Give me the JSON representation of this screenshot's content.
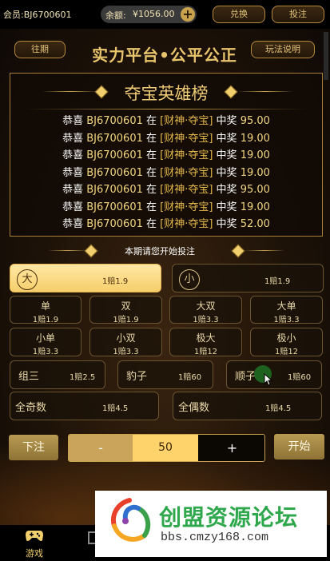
{
  "topbar": {
    "member_text": "会员:BJ6700601",
    "balance_label": "余额:",
    "balance_value": "¥1056.00",
    "exchange_label": "兑换",
    "bet_label": "投注"
  },
  "header": {
    "past_label": "往期",
    "title": "实力平台•公平公正",
    "rules_label": "玩法说明"
  },
  "board": {
    "title": "夺宝英雄榜",
    "rows": [
      {
        "prefix": "恭喜 ",
        "uid": "BJ6700601",
        "mid": " 在 ",
        "game": "[财神·夺宝]",
        "suffix": " 中奖 ",
        "amount": "95.00"
      },
      {
        "prefix": "恭喜 ",
        "uid": "BJ6700601",
        "mid": " 在 ",
        "game": "[财神·夺宝]",
        "suffix": " 中奖 ",
        "amount": "19.00"
      },
      {
        "prefix": "恭喜 ",
        "uid": "BJ6700601",
        "mid": " 在 ",
        "game": "[财神·夺宝]",
        "suffix": " 中奖 ",
        "amount": "19.00"
      },
      {
        "prefix": "恭喜 ",
        "uid": "BJ6700601",
        "mid": " 在 ",
        "game": "[财神·夺宝]",
        "suffix": " 中奖 ",
        "amount": "19.00"
      },
      {
        "prefix": "恭喜 ",
        "uid": "BJ6700601",
        "mid": " 在 ",
        "game": "[财神·夺宝]",
        "suffix": " 中奖 ",
        "amount": "95.00"
      },
      {
        "prefix": "恭喜 ",
        "uid": "BJ6700601",
        "mid": " 在 ",
        "game": "[财神·夺宝]",
        "suffix": " 中奖 ",
        "amount": "19.00"
      },
      {
        "prefix": "恭喜 ",
        "uid": "BJ6700601",
        "mid": " 在 ",
        "game": "[财神·夺宝]",
        "suffix": " 中奖 ",
        "amount": "52.00"
      }
    ]
  },
  "subheader": {
    "text": "本期请您开始投注"
  },
  "bets": {
    "big": {
      "label": "大",
      "odds": "1赔1.9"
    },
    "small": {
      "label": "小",
      "odds": "1赔1.9"
    },
    "grid": [
      {
        "label": "单",
        "odds": "1赔1.9"
      },
      {
        "label": "双",
        "odds": "1赔1.9"
      },
      {
        "label": "大双",
        "odds": "1赔3.3"
      },
      {
        "label": "大单",
        "odds": "1赔3.3"
      },
      {
        "label": "小单",
        "odds": "1赔3.3"
      },
      {
        "label": "小双",
        "odds": "1赔3.3"
      },
      {
        "label": "极大",
        "odds": "1赔12"
      },
      {
        "label": "极小",
        "odds": "1赔12"
      }
    ],
    "group3": {
      "label": "组三",
      "odds": "1赔2.5"
    },
    "leopard": {
      "label": "豹子",
      "odds": "1赔60"
    },
    "straight": {
      "label": "顺子",
      "odds": "1赔60"
    },
    "all_odd": {
      "label": "全奇数",
      "odds": "1赔4.5"
    },
    "all_even": {
      "label": "全偶数",
      "odds": "1赔4.5"
    }
  },
  "controls": {
    "place_bet_label": "下注",
    "minus_label": "-",
    "amount": "50",
    "plus_label": "+",
    "start_label": "开始"
  },
  "nav": {
    "game_label": "游戏",
    "game_icon": "gamepad-icon"
  },
  "watermark": {
    "text": "创盟资源论坛",
    "url": "bbs.cmzy168.com"
  },
  "colors": {
    "accent_gold": "#e8c46c",
    "active_bet": "#f6cf6c",
    "watermark_green": "#2fa84d"
  }
}
